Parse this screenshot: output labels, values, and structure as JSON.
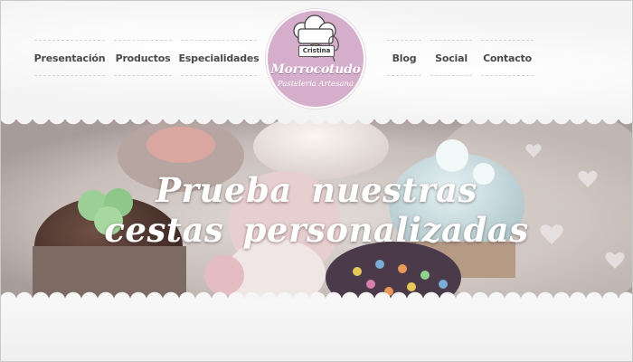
{
  "nav_left": [
    {
      "id": "nav-presentacion",
      "label": "Presentación"
    },
    {
      "id": "nav-productos",
      "label": "Productos"
    },
    {
      "id": "nav-especialidades",
      "label": "Especialidades"
    }
  ],
  "nav_right": [
    {
      "id": "nav-blog",
      "label": "Blog"
    },
    {
      "id": "nav-social",
      "label": "Social"
    },
    {
      "id": "nav-contacto",
      "label": "Contacto"
    }
  ],
  "logo": {
    "badge": "Cristina",
    "name": "Morrocotudo",
    "subtitle": "Pastelería Artesana",
    "icon": "chef-cupcake-icon",
    "circle_color": "#d5aecb"
  },
  "hero": {
    "headline": "Prueba nuestras  cestas personalizadas",
    "image": "cupcakes-photo"
  }
}
